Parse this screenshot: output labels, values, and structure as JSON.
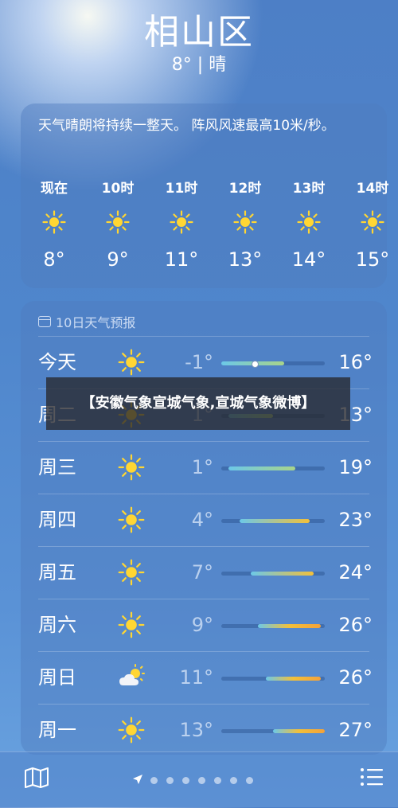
{
  "location": {
    "city": "相山区",
    "summary": "8° | 晴"
  },
  "hourly": {
    "description": "天气晴朗将持续一整天。 阵风风速最高10米/秒。",
    "items": [
      {
        "time": "现在",
        "icon": "sun-icon",
        "temp": "8°"
      },
      {
        "time": "10时",
        "icon": "sun-icon",
        "temp": "9°"
      },
      {
        "time": "11时",
        "icon": "sun-icon",
        "temp": "11°"
      },
      {
        "time": "12时",
        "icon": "sun-icon",
        "temp": "13°"
      },
      {
        "time": "13时",
        "icon": "sun-icon",
        "temp": "14°"
      },
      {
        "time": "14时",
        "icon": "sun-icon",
        "temp": "15°"
      }
    ]
  },
  "daily": {
    "title": "10日天气预报",
    "range": [
      -1,
      27
    ],
    "days": [
      {
        "name": "今天",
        "icon": "sun-icon",
        "low": "-1°",
        "high": "16°",
        "low_value": -1,
        "high_value": 16,
        "current_value": 8
      },
      {
        "name": "周二",
        "icon": "sun-icon",
        "low": "1°",
        "high": "13°",
        "low_value": 1,
        "high_value": 13
      },
      {
        "name": "周三",
        "icon": "sun-icon",
        "low": "1°",
        "high": "19°",
        "low_value": 1,
        "high_value": 19
      },
      {
        "name": "周四",
        "icon": "sun-icon",
        "low": "4°",
        "high": "23°",
        "low_value": 4,
        "high_value": 23
      },
      {
        "name": "周五",
        "icon": "sun-icon",
        "low": "7°",
        "high": "24°",
        "low_value": 7,
        "high_value": 24
      },
      {
        "name": "周六",
        "icon": "sun-icon",
        "low": "9°",
        "high": "26°",
        "low_value": 9,
        "high_value": 26
      },
      {
        "name": "周日",
        "icon": "partly-cloudy-icon",
        "low": "11°",
        "high": "26°",
        "low_value": 11,
        "high_value": 26
      },
      {
        "name": "周一",
        "icon": "sun-icon",
        "low": "13°",
        "high": "27°",
        "low_value": 13,
        "high_value": 27
      }
    ]
  },
  "overlay": {
    "text": "【安徽气象宣城气象,宣城气象微博】"
  },
  "bottom_bar": {
    "left_icon": "map-icon",
    "right_icon": "list-icon",
    "page_count": 7
  },
  "colors": {
    "cool": "#6cc8e8",
    "mild": "#a8d48a",
    "warm": "#f2c03a",
    "hot": "#f4a23a",
    "sun": "#ffd633"
  }
}
